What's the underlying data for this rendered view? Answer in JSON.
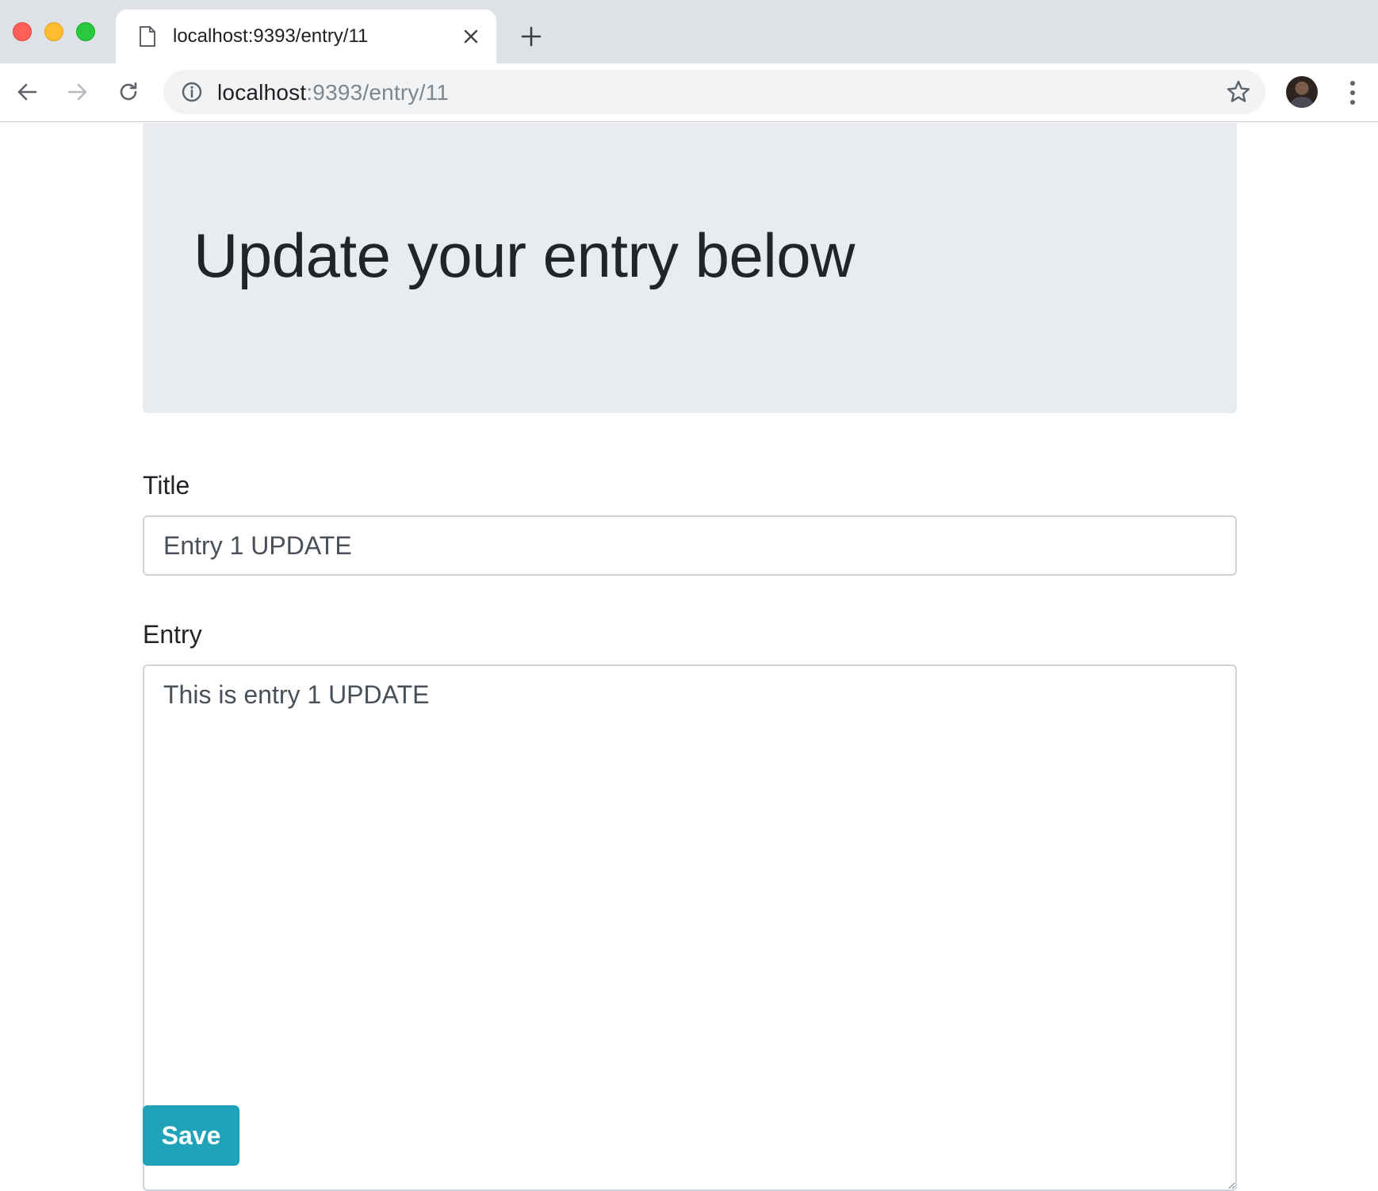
{
  "browser": {
    "tab": {
      "title": "localhost:9393/entry/11"
    },
    "address_bar": {
      "host": "localhost",
      "rest": ":9393/entry/11"
    },
    "icons": {
      "favicon": "page-icon",
      "tab_close": "close-icon",
      "new_tab": "plus-icon",
      "back": "arrow-left-icon",
      "forward": "arrow-right-icon",
      "reload": "reload-icon",
      "site_info": "info-icon",
      "bookmark": "star-icon",
      "menu": "more-vertical-icon"
    }
  },
  "page": {
    "heading": "Update your entry below",
    "form": {
      "title_label": "Title",
      "title_value": "Entry 1 UPDATE",
      "entry_label": "Entry",
      "entry_value": "This is entry 1 UPDATE",
      "save_label": "Save"
    }
  },
  "colors": {
    "jumbotron_bg": "#e9ecef",
    "button_bg": "#20a2b8",
    "text": "#212529",
    "input_border": "#ced4da"
  }
}
